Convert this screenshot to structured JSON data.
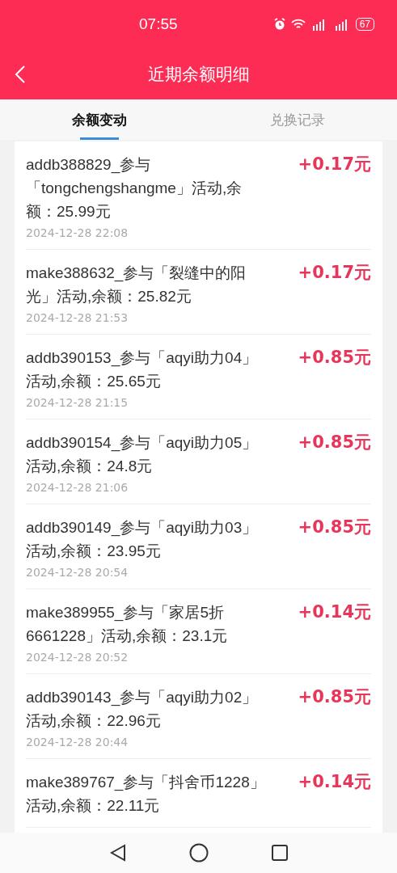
{
  "status_bar": {
    "time": "07:55",
    "battery": "67"
  },
  "header": {
    "title": "近期余额明细"
  },
  "tabs": [
    {
      "label": "余额变动",
      "selected": true
    },
    {
      "label": "兑换记录",
      "selected": false
    }
  ],
  "records": [
    {
      "description": "addb388829_参与「tongchengshangme」活动,余额：25.99元",
      "amount": "+0.17元",
      "time": "2024-12-28 22:08"
    },
    {
      "description": "make388632_参与「裂缝中的阳光」活动,余额：25.82元",
      "amount": "+0.17元",
      "time": "2024-12-28 21:53"
    },
    {
      "description": "addb390153_参与「aqyi助力04」活动,余额：25.65元",
      "amount": "+0.85元",
      "time": "2024-12-28 21:15"
    },
    {
      "description": "addb390154_参与「aqyi助力05」活动,余额：24.8元",
      "amount": "+0.85元",
      "time": "2024-12-28 21:06"
    },
    {
      "description": "addb390149_参与「aqyi助力03」活动,余额：23.95元",
      "amount": "+0.85元",
      "time": "2024-12-28 20:54"
    },
    {
      "description": "make389955_参与「家居5折6661228」活动,余额：23.1元",
      "amount": "+0.14元",
      "time": "2024-12-28 20:52"
    },
    {
      "description": "addb390143_参与「aqyi助力02」活动,余额：22.96元",
      "amount": "+0.85元",
      "time": "2024-12-28 20:44"
    },
    {
      "description": "make389767_参与「抖舍币1228」活动,余额：22.11元",
      "amount": "+0.14元"
    }
  ]
}
